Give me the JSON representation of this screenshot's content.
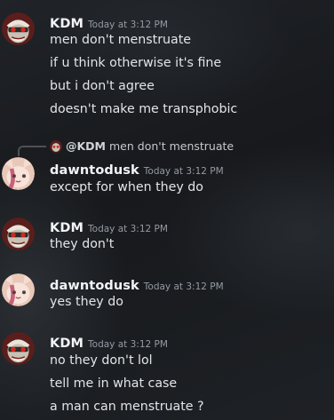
{
  "messages": [
    {
      "author": "KDM",
      "timestamp": "Today at 3:12 PM",
      "avatar": "kdm-avatar",
      "lines": [
        "men don't menstruate",
        "if u think otherwise it's fine",
        "but i don't agree",
        "doesn't make me transphobic"
      ]
    },
    {
      "reply_to": {
        "author": "@KDM",
        "text": "men don't menstruate"
      },
      "author": "dawntodusk",
      "timestamp": "Today at 3:12 PM",
      "avatar": "dawntodusk-avatar",
      "lines": [
        "except for when they do"
      ]
    },
    {
      "author": "KDM",
      "timestamp": "Today at 3:12 PM",
      "avatar": "kdm-avatar",
      "lines": [
        "they don't"
      ]
    },
    {
      "author": "dawntodusk",
      "timestamp": "Today at 3:12 PM",
      "avatar": "dawntodusk-avatar",
      "lines": [
        "yes they do"
      ]
    },
    {
      "author": "KDM",
      "timestamp": "Today at 3:12 PM",
      "avatar": "kdm-avatar",
      "lines": [
        "no they don't lol",
        "tell me in what case",
        "a man can menstruate ?"
      ]
    }
  ],
  "colors": {
    "username": "#f2f3f5",
    "timestamp": "#949ba4",
    "message_text": "#e3e5e8",
    "background": "#1b1d21"
  }
}
